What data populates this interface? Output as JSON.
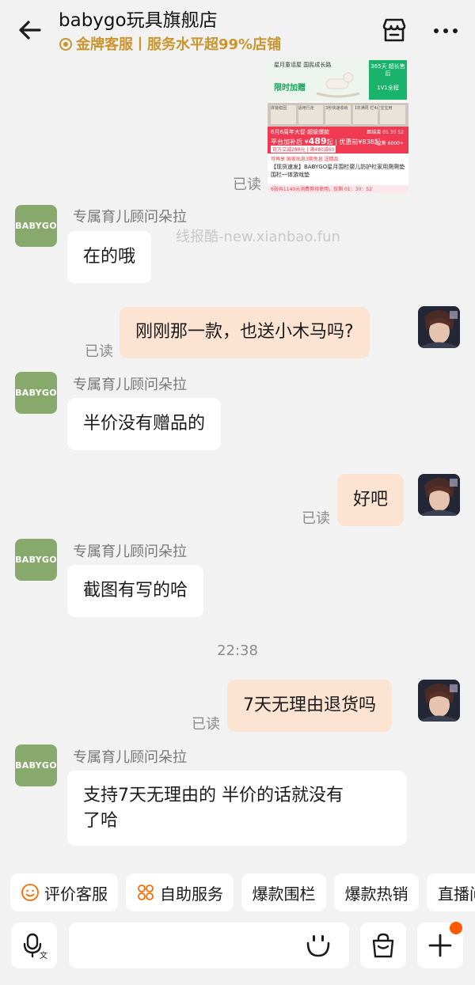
{
  "header": {
    "shop_name": "babygo玩具旗舰店",
    "badge_text": "金牌客服丨服务水平超99%店铺",
    "badge_color": "#c9952f"
  },
  "product_card": {
    "slogan": "星月童话屋 国民成长路",
    "green_badge": "365天 超长售后",
    "green_sub": "1V1全程",
    "limit_label": "限时加赠",
    "thumbs": [
      "拼装稳固",
      "适用行走",
      "3秒快速收纳",
      "【年满周 栏4cm 长",
      "宝宝用"
    ],
    "promo_line": "6月6周年大促·超级爆款",
    "price_line_prefix": "平台加补后 ¥",
    "price": "489",
    "price_suffix": "起 | 优惠前¥838起",
    "coupon_line": "官方立减289元 | 满480减60",
    "timer": "距结束 01 30 52",
    "sold": "已售 6000+",
    "tags": "可再享  国家贴息3期免息  送精品",
    "title": "【现货速发】BABYGO星月围栏婴儿防护栏家用爬爬垫围栏一体游戏垫",
    "bottom_note": "6张共1140元消费券待使用，仅剩 01：30：52"
  },
  "read_label": "已读",
  "watermark": "线报酷-new.xianbao.fun",
  "shop_avatar_text": "BABYGO",
  "agent_name": "专属育儿顾问朵拉",
  "messages": {
    "m1": "在的哦",
    "m2": "刚刚那一款，也送小木马吗?",
    "m3": "半价没有赠品的",
    "m4": "好吧",
    "m5": "截图有写的哈",
    "m6": "7天无理由退货吗",
    "m7_line1": "支持7天无理由的 半价的话就没有",
    "m7_line2": "了哈"
  },
  "timestamp": "22:38",
  "quick_actions": [
    "评价客服",
    "自助服务",
    "爆款围栏",
    "爆款热销",
    "直播间"
  ],
  "colors": {
    "outgoing_bubble": "#fde3d2",
    "incoming_bubble": "#ffffff",
    "shop_avatar": "#87a96b",
    "notification_dot": "#ff5a00"
  }
}
